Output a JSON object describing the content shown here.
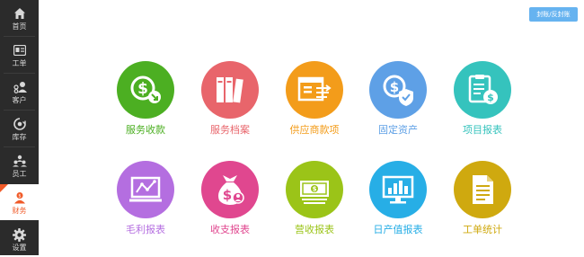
{
  "sidebar": {
    "items": [
      {
        "label": "首页",
        "icon": "home-icon"
      },
      {
        "label": "工单",
        "icon": "ticket-icon"
      },
      {
        "label": "客户",
        "icon": "customer-icon"
      },
      {
        "label": "库存",
        "icon": "inventory-icon"
      },
      {
        "label": "员工",
        "icon": "staff-icon"
      },
      {
        "label": "财务",
        "icon": "finance-icon",
        "active": true
      },
      {
        "label": "设置",
        "icon": "gear-icon"
      }
    ]
  },
  "header": {
    "button_label": "封账/反封账"
  },
  "modules": [
    {
      "label": "服务收款",
      "color": "#4caf22",
      "text_color": "#4caf22",
      "icon": "service-payment-icon"
    },
    {
      "label": "服务档案",
      "color": "#e8656b",
      "text_color": "#e8656b",
      "icon": "service-archive-icon"
    },
    {
      "label": "供应商款项",
      "color": "#f39c1a",
      "text_color": "#f39c1a",
      "icon": "supplier-payment-icon"
    },
    {
      "label": "固定资产",
      "color": "#5ea0e6",
      "text_color": "#5ea0e6",
      "icon": "fixed-asset-icon"
    },
    {
      "label": "项目报表",
      "color": "#35c3bd",
      "text_color": "#35c3bd",
      "icon": "project-report-icon"
    },
    {
      "label": "毛利报表",
      "color": "#b46ee0",
      "text_color": "#b46ee0",
      "icon": "gross-profit-report-icon"
    },
    {
      "label": "收支报表",
      "color": "#e0478f",
      "text_color": "#e0478f",
      "icon": "income-expense-report-icon"
    },
    {
      "label": "营收报表",
      "color": "#9bc418",
      "text_color": "#9bc418",
      "icon": "revenue-report-icon"
    },
    {
      "label": "日产值报表",
      "color": "#27aee6",
      "text_color": "#27aee6",
      "icon": "daily-output-report-icon"
    },
    {
      "label": "工单统计",
      "color": "#cfa90f",
      "text_color": "#cfa90f",
      "icon": "ticket-statistics-icon"
    }
  ]
}
